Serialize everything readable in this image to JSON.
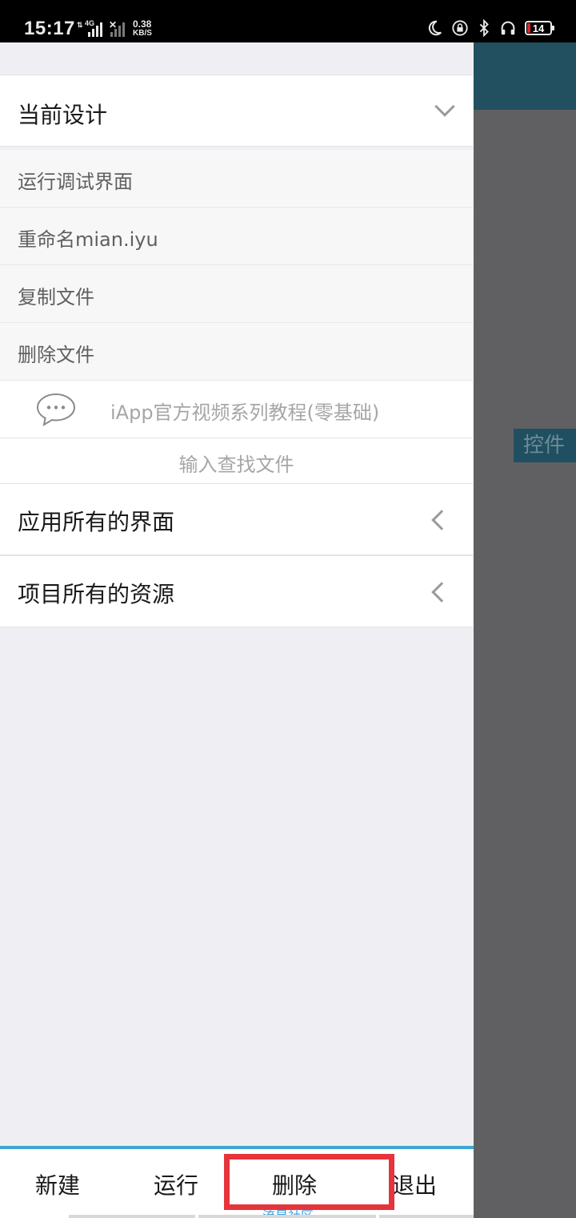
{
  "status_bar": {
    "time": "15:17",
    "net_type_1": "4G",
    "net_speed_value": "0.38",
    "net_speed_unit": "KB/S",
    "battery_level": "14",
    "icons": [
      "moon-icon",
      "lock-rotation-icon",
      "bluetooth-icon",
      "headphones-icon",
      "battery-icon"
    ]
  },
  "background_app": {
    "control_label": "控件",
    "bar_color": "#225060"
  },
  "drawer": {
    "current_design": {
      "label": "当前设计",
      "expanded": true
    },
    "menu_items": [
      {
        "label": "运行调试界面"
      },
      {
        "label": "重命名mian.iyu"
      },
      {
        "label": "复制文件"
      },
      {
        "label": "删除文件"
      }
    ],
    "tutorial": {
      "label": "iApp官方视频系列教程(零基础)",
      "icon": "chat-bubble-icon"
    },
    "search": {
      "label": "输入查找文件"
    },
    "sections": [
      {
        "label": "应用所有的界面",
        "expanded": false
      },
      {
        "label": "项目所有的资源",
        "expanded": false
      }
    ]
  },
  "toolbar": {
    "new_label": "新建",
    "run_label": "运行",
    "delete_label": "删除",
    "exit_label": "退出",
    "footer_text": "流星社区",
    "accent_color": "#3fa7cf",
    "highlight_color": "#e5343b"
  }
}
